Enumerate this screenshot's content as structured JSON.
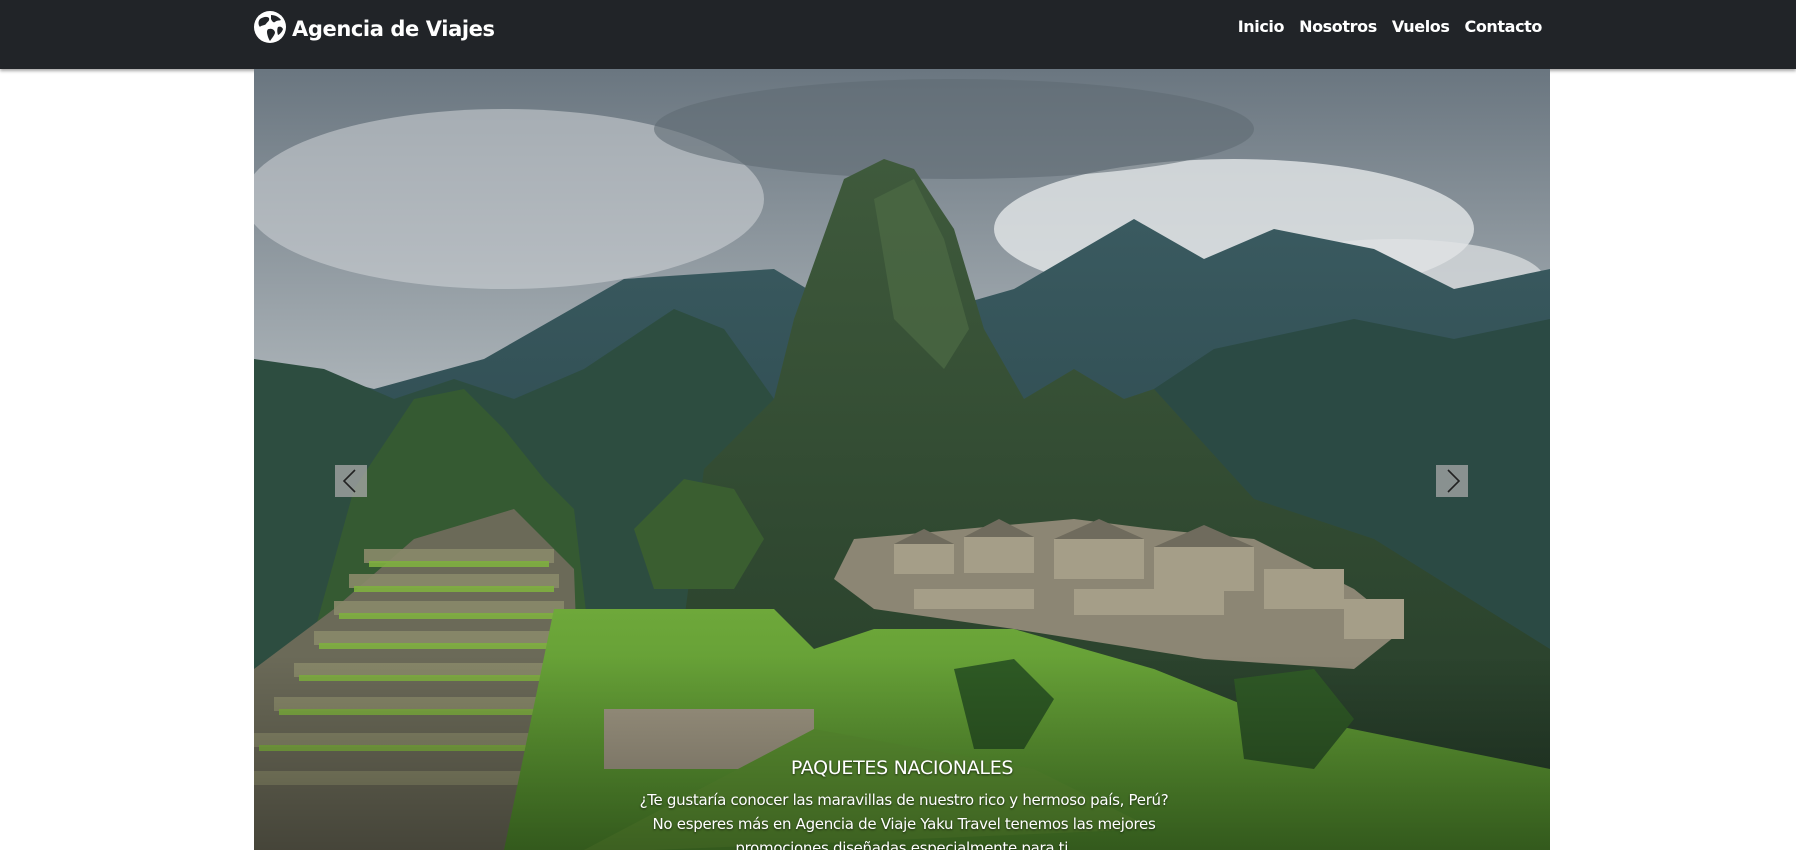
{
  "navbar": {
    "brand": {
      "icon": "globe-icon",
      "label": "Agencia de Viajes"
    },
    "links": [
      {
        "label": "Inicio"
      },
      {
        "label": "Nosotros"
      },
      {
        "label": "Vuelos"
      },
      {
        "label": "Contacto"
      }
    ]
  },
  "carousel": {
    "image": "machu-picchu-photo",
    "prev_icon": "chevron-left-icon",
    "next_icon": "chevron-right-icon",
    "caption": {
      "title": "PAQUETES NACIONALES",
      "text": "¿Te gustaría conocer las maravillas de nuestro rico y hermoso país, Perú? No esperes más en Agencia de Viaje Yaku Travel tenemos las mejores promociones diseñadas especialmente para ti."
    }
  },
  "colors": {
    "navbar_bg": "#212428",
    "text": "#ffffff",
    "control_bg": "#aaaaaa"
  }
}
